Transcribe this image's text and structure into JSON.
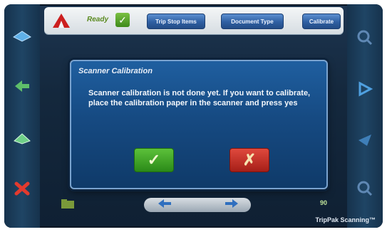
{
  "topbar": {
    "status_label": "Ready",
    "buttons": [
      "Trip Stop Items",
      "Document Type",
      "Calibrate"
    ]
  },
  "dialog": {
    "title": "Scanner Calibration",
    "message": "Scanner calibration is not done yet. If you want to calibrate, place the calibration paper in the scanner and press yes",
    "yes_symbol": "✓",
    "no_symbol": "✗"
  },
  "bottom": {
    "counter": "90",
    "product_name": "TripPak Scanning™"
  },
  "colors": {
    "accent": "#1f5fa0",
    "yes": "#2b8a18",
    "no": "#a61f18"
  }
}
